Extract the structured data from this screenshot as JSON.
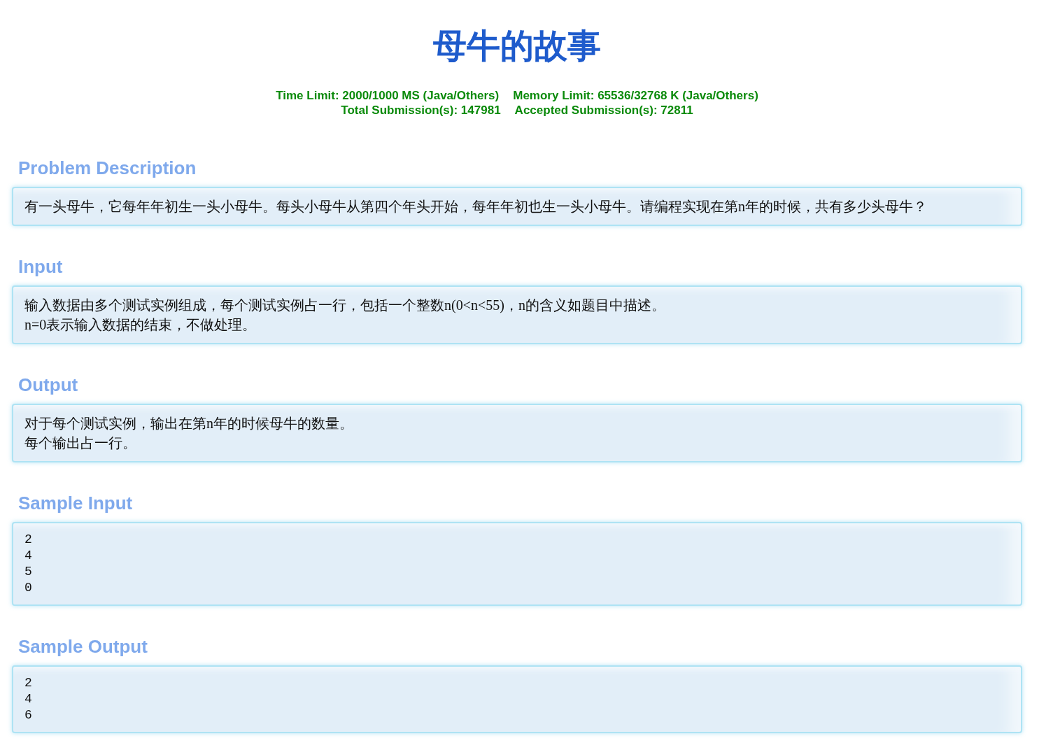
{
  "title": "母牛的故事",
  "stats_lines": [
    {
      "items": [
        "Time Limit: 2000/1000 MS (Java/Others)",
        "Memory Limit: 65536/32768 K (Java/Others)"
      ]
    },
    {
      "items": [
        "Total Submission(s): 147981",
        "Accepted Submission(s): 72811"
      ]
    }
  ],
  "sections": [
    {
      "heading": "Problem Description",
      "kind": "text",
      "lines": [
        "有一头母牛，它每年年初生一头小母牛。每头小母牛从第四个年头开始，每年年初也生一头小母牛。请编程实现在第n年的时候，共有多少头母牛？"
      ]
    },
    {
      "heading": "Input",
      "kind": "text",
      "lines": [
        "输入数据由多个测试实例组成，每个测试实例占一行，包括一个整数n(0<n<55)，n的含义如题目中描述。",
        "n=0表示输入数据的结束，不做处理。"
      ]
    },
    {
      "heading": "Output",
      "kind": "text",
      "lines": [
        "对于每个测试实例，输出在第n年的时候母牛的数量。",
        "每个输出占一行。"
      ]
    },
    {
      "heading": "Sample Input",
      "kind": "code",
      "lines": [
        "2",
        "4",
        "5",
        "0"
      ]
    },
    {
      "heading": "Sample Output",
      "kind": "code",
      "lines": [
        "2",
        "4",
        "6"
      ]
    }
  ]
}
